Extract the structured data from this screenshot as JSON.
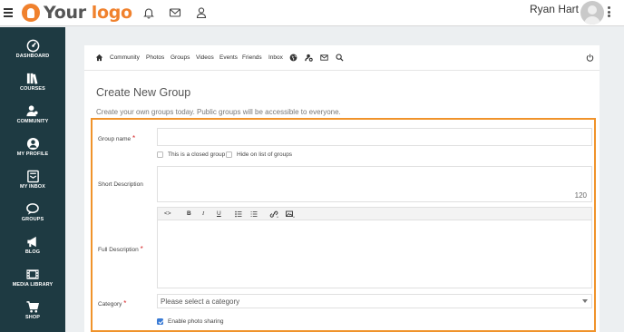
{
  "header": {
    "logo": {
      "word1": "Your",
      "word2": "logo"
    },
    "icons": [
      "bell-icon",
      "mail-icon",
      "user-icon"
    ],
    "user_name": "Ryan Hart"
  },
  "sidebar": {
    "items": [
      {
        "label": "DASHBOARD",
        "icon": "dashboard-icon"
      },
      {
        "label": "COURSES",
        "icon": "books-icon"
      },
      {
        "label": "COMMUNITY",
        "icon": "community-icon"
      },
      {
        "label": "MY PROFILE",
        "icon": "profile-icon"
      },
      {
        "label": "MY INBOX",
        "icon": "inbox-icon"
      },
      {
        "label": "GROUPS",
        "icon": "chat-icon"
      },
      {
        "label": "BLOG",
        "icon": "megaphone-icon"
      },
      {
        "label": "MEDIA LIBRARY",
        "icon": "film-icon"
      },
      {
        "label": "SHOP",
        "icon": "cart-icon"
      }
    ]
  },
  "subnav": {
    "items": [
      "Community",
      "Photos",
      "Groups",
      "Videos",
      "Events",
      "Friends",
      "Inbox"
    ]
  },
  "page": {
    "title": "Create New Group",
    "subtitle": "Create your own groups today. Public groups will be accessible to everyone."
  },
  "form": {
    "group_name_label": "Group name",
    "required_mark": "*",
    "closed_group_label": "This is a closed group",
    "hide_label": "Hide on list of groups",
    "short_description_label": "Short Description",
    "char_counter": "120",
    "full_description_label": "Full Description",
    "category_label": "Category",
    "category_placeholder": "Please select a category",
    "photo_sharing_label": "Enable photo sharing",
    "toolbar": {
      "code": "<>",
      "bold": "B",
      "italic": "I",
      "underline": "U"
    }
  },
  "colors": {
    "accent_orange": "#f0812d",
    "sidebar_bg": "#1e3a42",
    "highlight_border": "#f0932b",
    "checkbox_blue": "#3a7bd5"
  }
}
